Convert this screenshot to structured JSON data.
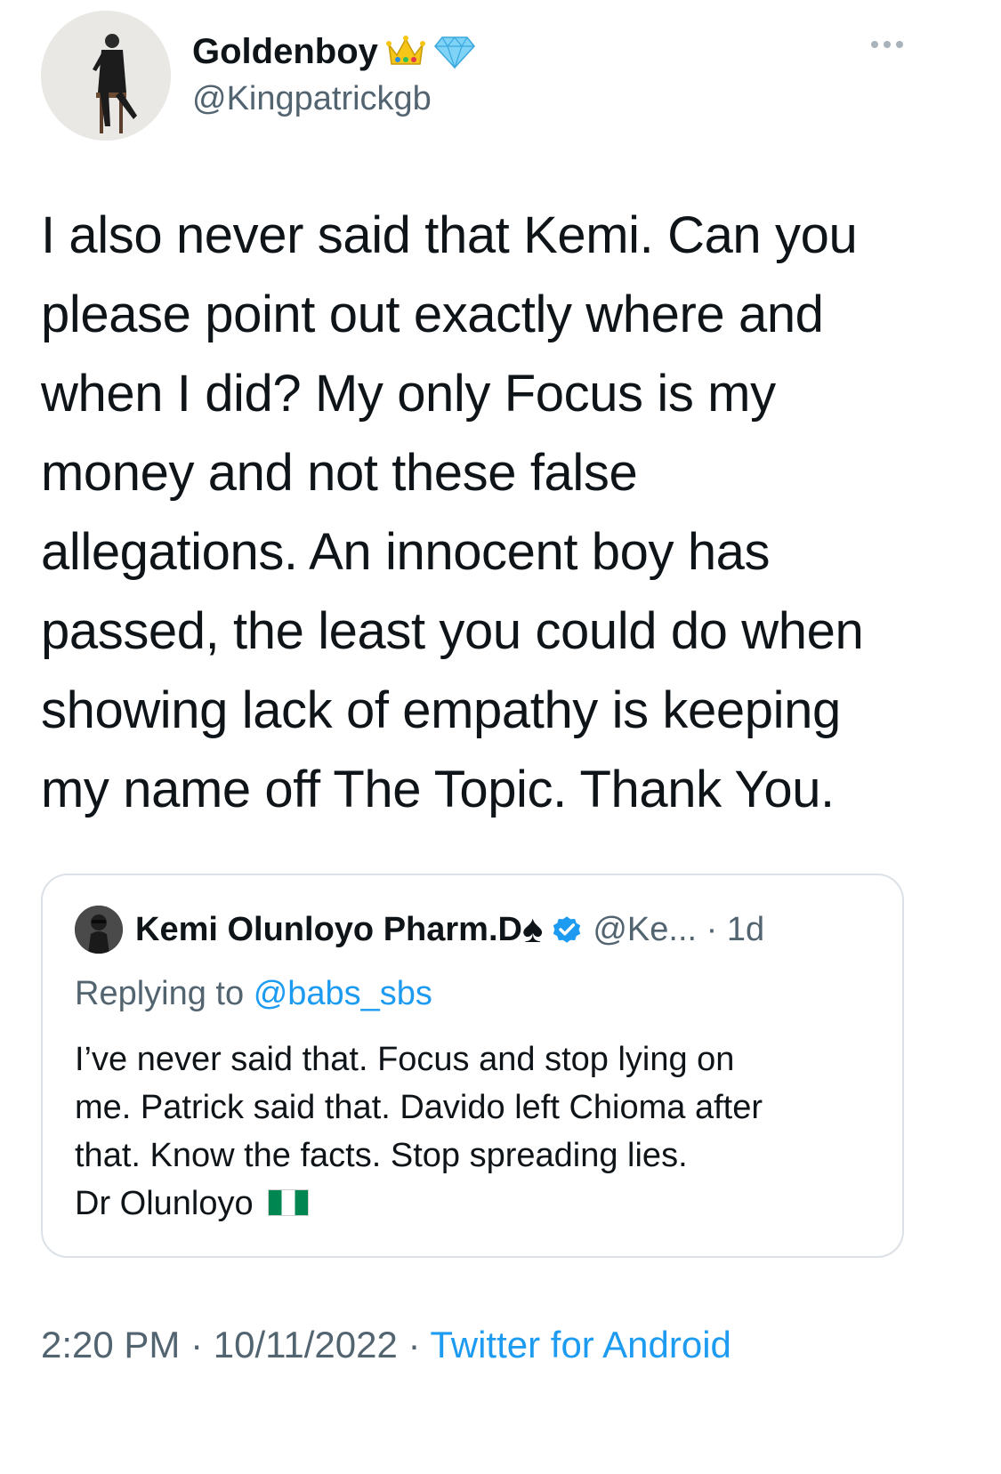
{
  "author": {
    "display_name": "Goldenboy",
    "badges": [
      "crown-emoji",
      "gem-emoji"
    ],
    "handle": "@Kingpatrickgb"
  },
  "tweet": {
    "text": "I also never said that Kemi. Can you\nplease point out exactly where and\nwhen I did? My only Focus is my\nmoney and not these false\nallegations. An innocent boy has\npassed, the least you could do when\nshowing lack of empathy is keeping\nmy name off The Topic. Thank You."
  },
  "quoted_tweet": {
    "author_name": "Kemi Olunloyo Pharm.D",
    "name_suffix": "♠",
    "verified": true,
    "meta": "@Ke... · 1d",
    "replying_prefix": "Replying to",
    "replying_to": "@babs_sbs",
    "text": "I’ve never said that. Focus and stop lying on\nme. Patrick said that. Davido left Chioma after\nthat. Know the facts. Stop spreading lies.\nDr Olunloyo",
    "flag": "nigeria-flag-icon"
  },
  "footer": {
    "time": "2:20 PM",
    "separator": " · ",
    "date": "10/11/2022",
    "source": "Twitter for Android"
  },
  "colors": {
    "text": "#0f1419",
    "secondary": "#536471",
    "link": "#1d9bf0",
    "border": "#dbe1e6",
    "verified": "#1d9bf0"
  }
}
